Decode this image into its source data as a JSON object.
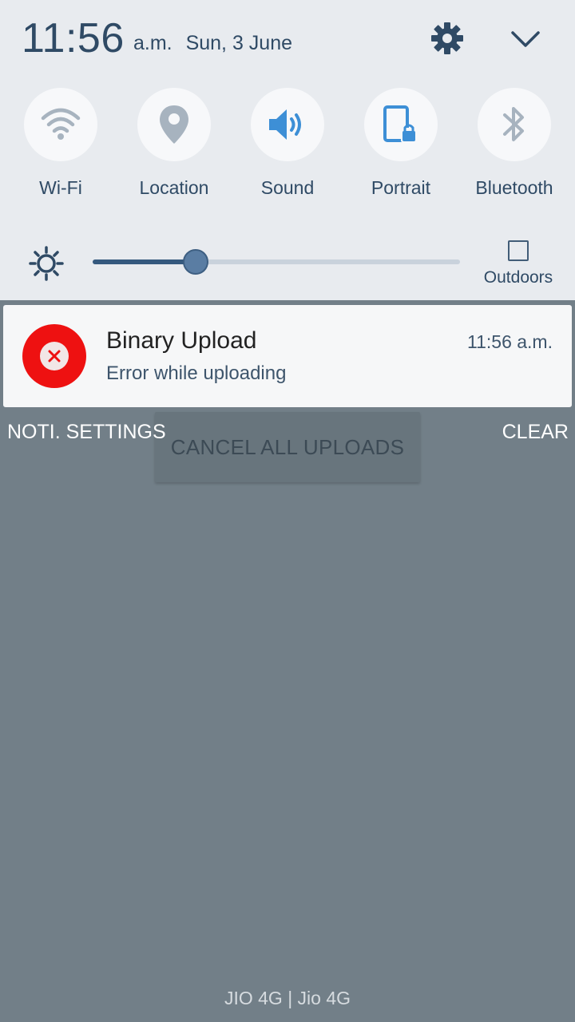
{
  "status": {
    "time": "11:56",
    "ampm": "a.m.",
    "date": "Sun, 3 June"
  },
  "quick_toggles": [
    {
      "label": "Wi-Fi",
      "icon": "wifi-icon",
      "active": false
    },
    {
      "label": "Location",
      "icon": "location-icon",
      "active": false
    },
    {
      "label": "Sound",
      "icon": "sound-icon",
      "active": true
    },
    {
      "label": "Portrait",
      "icon": "portrait-lock-icon",
      "active": true
    },
    {
      "label": "Bluetooth",
      "icon": "bluetooth-icon",
      "active": false
    }
  ],
  "brightness": {
    "level": 0.28,
    "outdoors_label": "Outdoors"
  },
  "notification": {
    "title": "Binary Upload",
    "message": "Error while uploading",
    "time": "11:56 a.m.",
    "icon": "error-x-icon",
    "icon_color": "#ee1111"
  },
  "actions": {
    "noti_settings": "NOTI. SETTINGS",
    "clear": "CLEAR",
    "cancel_all": "CANCEL ALL UPLOADS"
  },
  "carrier": "JIO 4G | Jio 4G",
  "colors": {
    "accent_blue": "#3d8fd6",
    "inactive_icon": "#a7b3bf",
    "text_primary": "#2f4a65",
    "shade_bg": "#727f88"
  }
}
